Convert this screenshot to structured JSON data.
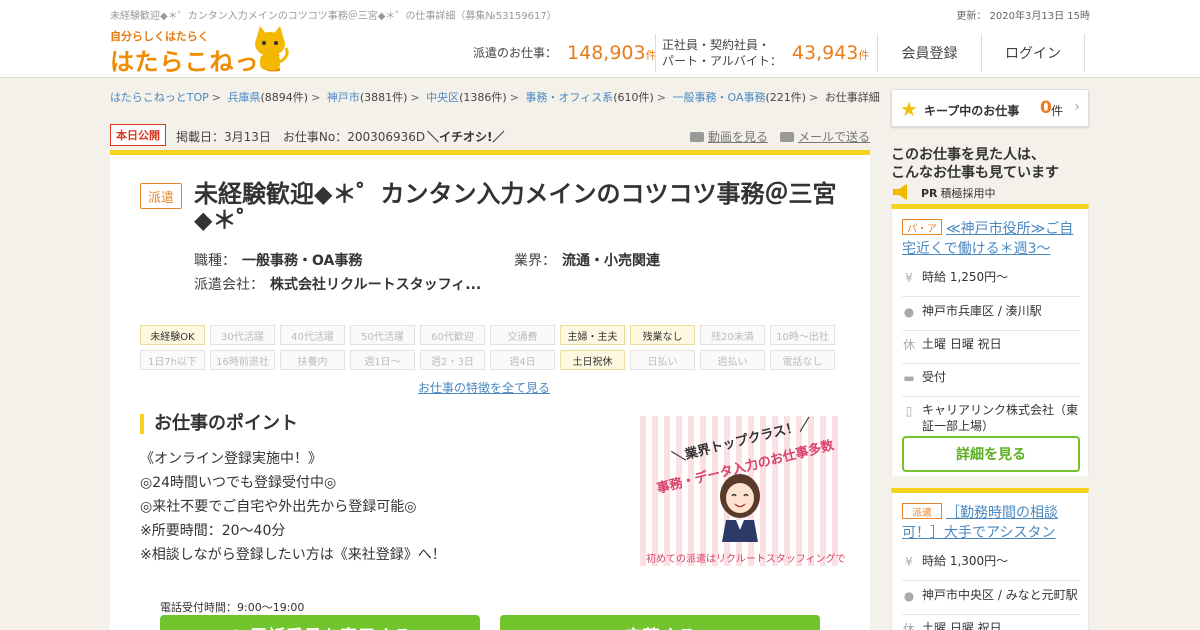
{
  "header": {
    "sub_title": "未経験歓迎◆＊゜カンタン入力メインのコツコツ事務＠三宮◆＊゜の仕事詳細（募集№53159617）",
    "updated": "更新： 2020年3月13日 15時",
    "logo_tag": "自分らしくはたらく",
    "logo_main": "はたらこねっと",
    "stats": [
      {
        "label": "派遣のお仕事：",
        "value": "148,903",
        "unit": "件"
      },
      {
        "label_line1": "正社員・契約社員・",
        "label_line2": "パート・アルバイト：",
        "value": "43,943",
        "unit": "件"
      }
    ],
    "nav": {
      "register": "会員登録",
      "login": "ログイン"
    }
  },
  "breadcrumb": [
    {
      "label": "はたらこねっとTOP",
      "count": ""
    },
    {
      "label": "兵庫県",
      "count": "(8894件)"
    },
    {
      "label": "神戸市",
      "count": "(3881件)"
    },
    {
      "label": "中央区",
      "count": "(1386件)"
    },
    {
      "label": "事務・オフィス系",
      "count": "(610件)"
    },
    {
      "label": "一般事務・OA事務",
      "count": "(221件)"
    }
  ],
  "breadcrumb_current": "お仕事詳細",
  "breadcrumb_sep": ">",
  "meta": {
    "badge": "本日公開",
    "posted": "掲載日：3月13日　お仕事No：200306936D",
    "recommend": "＼イチオシ!／",
    "video_link": "動画を見る",
    "mail_link": "メールで送る"
  },
  "job": {
    "type_tag": "派遣",
    "title": "未経験歓迎◆＊゜カンタン入力メインのコツコツ事務＠三宮◆＊゜",
    "occupation_label": "職種：",
    "occupation": "一般事務・OA事務",
    "industry_label": "業界：",
    "industry": "流通・小売関連",
    "agency_label": "派遣会社：",
    "agency": "株式会社リクルートスタッフィ..."
  },
  "features_row1": [
    {
      "label": "未経験OK",
      "on": true
    },
    {
      "label": "30代活躍",
      "on": false
    },
    {
      "label": "40代活躍",
      "on": false
    },
    {
      "label": "50代活躍",
      "on": false
    },
    {
      "label": "60代歓迎",
      "on": false
    },
    {
      "label": "交通費",
      "on": false
    },
    {
      "label": "主婦・主夫",
      "on": true
    },
    {
      "label": "残業なし",
      "on": true
    },
    {
      "label": "残20未満",
      "on": false
    },
    {
      "label": "10時～出社",
      "on": false
    }
  ],
  "features_row2": [
    {
      "label": "1日7h以下",
      "on": false
    },
    {
      "label": "16時前退社",
      "on": false
    },
    {
      "label": "扶養内",
      "on": false
    },
    {
      "label": "週1日～",
      "on": false
    },
    {
      "label": "週2・3日",
      "on": false
    },
    {
      "label": "週4日",
      "on": false
    },
    {
      "label": "土日祝休",
      "on": true
    },
    {
      "label": "日払い",
      "on": false
    },
    {
      "label": "週払い",
      "on": false
    },
    {
      "label": "電話なし",
      "on": false
    }
  ],
  "features_more": "お仕事の特徴を全て見る",
  "points": {
    "heading": "お仕事のポイント",
    "lines": [
      "《オンライン登録実施中！》",
      "◎24時間いつでも登録受付中◎",
      "◎来社不要でご自宅や外出先から登録可能◎",
      "※所要時間：20～40分",
      "※相談しながら登録したい方は《来社登録》へ！"
    ]
  },
  "promo": {
    "line1": "＼業界トップクラス！／",
    "line2": "事務・データ入力のお仕事多数",
    "footer": "初めての派遣はリクルートスタッフィングで"
  },
  "actions": {
    "tel_note": "電話受付時間：9:00～19:00",
    "tel_button": "✆ 電話番号を表示する",
    "apply_button": "応募する"
  },
  "sidebar": {
    "keep_label": "キープ中のお仕事",
    "keep_count": "0",
    "keep_unit": "件",
    "heading_line1": "このお仕事を見た人は、",
    "heading_line2": "こんなお仕事も見ています",
    "pr": "PR",
    "pr_text": "積極採用中",
    "cards": [
      {
        "tag": "パ・ア",
        "title": "≪神戸市役所≫ご自宅近くで働ける＊週3～",
        "wage": "時給 1,250円～",
        "location": "神戸市兵庫区 / 湊川駅",
        "holiday": "土曜 日曜 祝日",
        "apply": "受付",
        "company": "キャリアリンク株式会社（東証一部上場）",
        "detail_button": "詳細を見る"
      },
      {
        "tag": "派遣",
        "title": "［勤務時間の相談可！］大手でアシスタン",
        "wage": "時給 1,300円～",
        "location": "神戸市中央区 / みなと元町駅",
        "holiday": "土曜 日曜 祝日"
      }
    ]
  },
  "colors": {
    "accent_orange": "#e97c1a",
    "accent_yellow": "#f5d21c",
    "green_button": "#71c42c",
    "link_blue": "#4a88c2"
  }
}
